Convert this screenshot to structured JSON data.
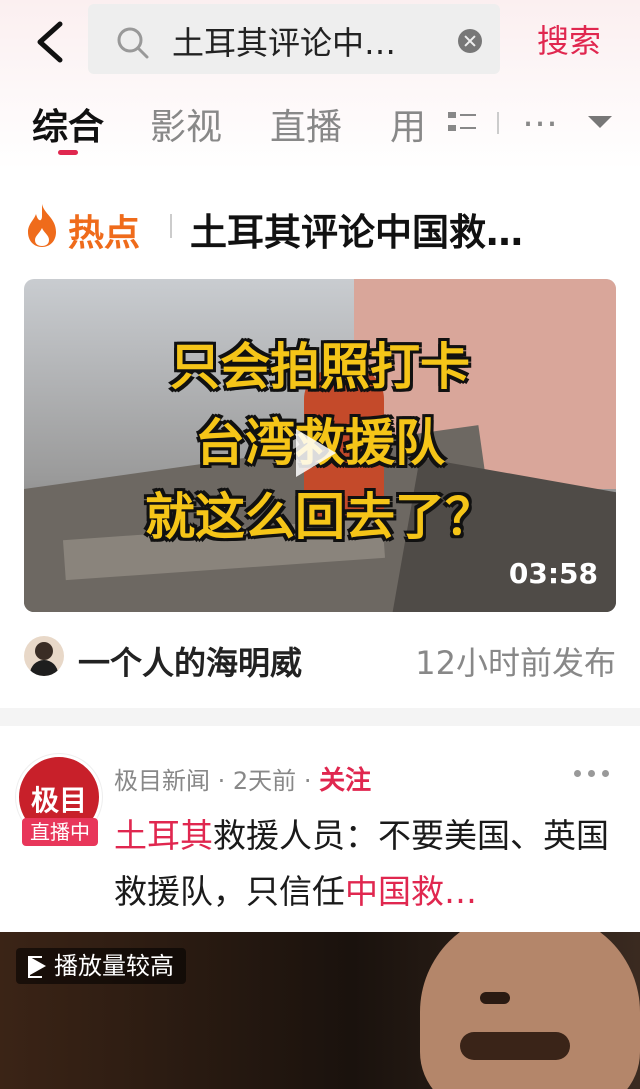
{
  "header": {
    "search_query": "土耳其评论中…",
    "search_button": "搜索"
  },
  "tabs": [
    {
      "label": "综合",
      "active": true
    },
    {
      "label": "影视"
    },
    {
      "label": "直播"
    },
    {
      "label": "用"
    },
    {
      "label": "…"
    }
  ],
  "hot": {
    "label": "热点",
    "title": "土耳其评论中国救…"
  },
  "featured": {
    "caption_lines": [
      "只会拍照打卡",
      "台湾救援队",
      "就这么回去了？"
    ],
    "duration": "03:58",
    "author": "一个人的海明威",
    "time": "12小时前发布"
  },
  "post": {
    "source": "极目新闻",
    "logo_text": "极目",
    "live_badge": "直播中",
    "age": "2天前",
    "follow": "关注",
    "title_parts": [
      {
        "text": "土耳其",
        "highlight": true
      },
      {
        "text": "救援人员：不要美国、英国救援队，只信任",
        "highlight": false
      },
      {
        "text": "中国救…",
        "highlight": true
      }
    ],
    "video_badge": "播放量较高"
  },
  "colors": {
    "accent": "#e0274f",
    "hot": "#ef6b1b"
  }
}
